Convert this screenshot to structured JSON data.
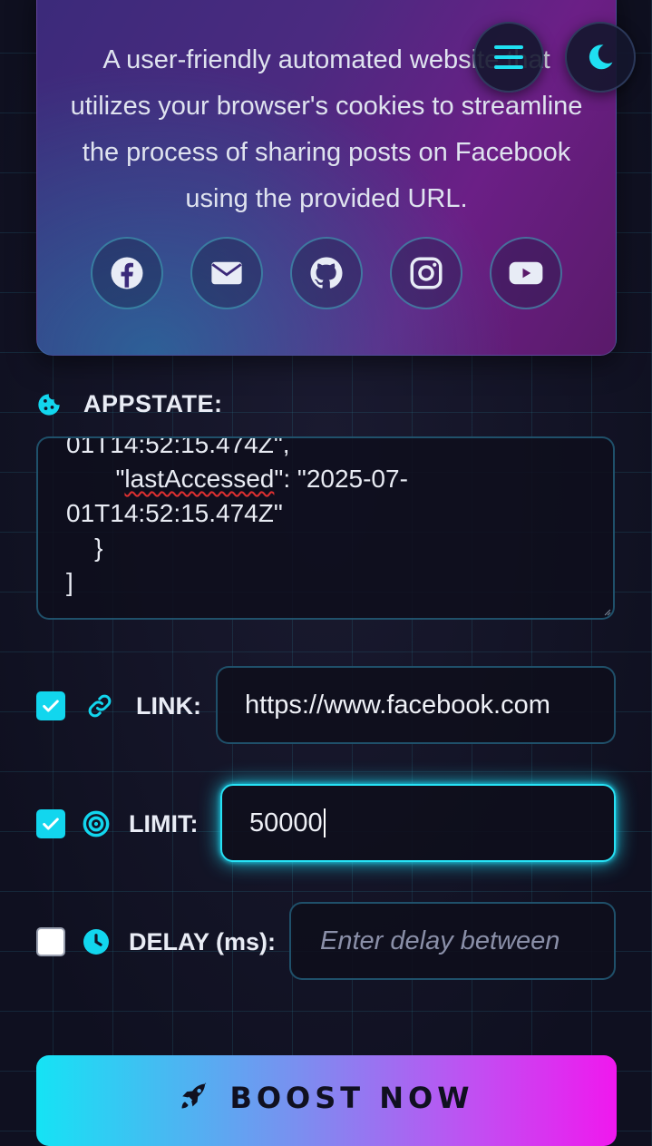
{
  "header": {
    "description": "A user-friendly automated website that utilizes your browser's cookies to streamline the process of sharing posts on Facebook using the provided URL.",
    "menu_icon": "hamburger-menu-icon",
    "theme_icon": "moon-icon"
  },
  "socials": [
    {
      "name": "facebook",
      "icon": "facebook-icon"
    },
    {
      "name": "email",
      "icon": "envelope-icon"
    },
    {
      "name": "github",
      "icon": "github-icon"
    },
    {
      "name": "instagram",
      "icon": "instagram-icon"
    },
    {
      "name": "youtube",
      "icon": "youtube-icon"
    }
  ],
  "appstate": {
    "label": "APPSTATE:",
    "icon": "cookie-icon",
    "lines": {
      "l1": "01T14:52:15.474Z\",",
      "l2_indent": "       \"",
      "l2_key": "lastAccessed",
      "l2_rest": "\": \"2025-07-",
      "l3": "01T14:52:15.474Z\"",
      "l4": "    }",
      "l5": "]"
    }
  },
  "link": {
    "checked": true,
    "label": "LINK:",
    "icon": "link-icon",
    "value": "https://www.facebook.com"
  },
  "limit": {
    "checked": true,
    "label": "LIMIT:",
    "icon": "target-icon",
    "value": "50000"
  },
  "delay": {
    "checked": false,
    "label": "DELAY (ms):",
    "icon": "clock-icon",
    "placeholder": "Enter delay between"
  },
  "boost": {
    "label": "BOOST NOW",
    "icon": "rocket-icon"
  },
  "colors": {
    "accent": "#12d6ee",
    "gradient_start": "#15e3f4",
    "gradient_end": "#f018ee"
  }
}
